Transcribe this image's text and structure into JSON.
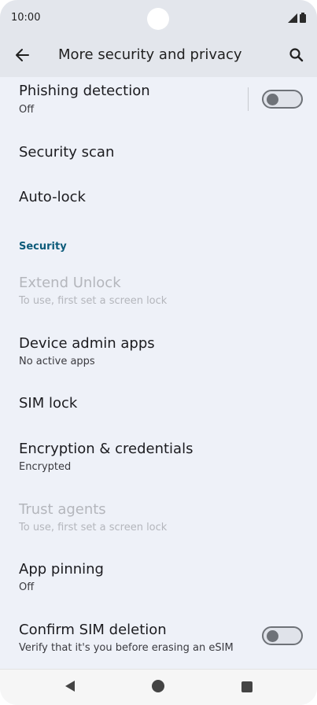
{
  "status_bar": {
    "time": "10:00"
  },
  "app_bar": {
    "title": "More security and privacy"
  },
  "items": {
    "phishing": {
      "title": "Phishing detection",
      "subtitle": "Off",
      "toggle_state": "off"
    },
    "security_scan": {
      "title": "Security scan"
    },
    "auto_lock": {
      "title": "Auto-lock"
    },
    "section_security": "Security",
    "extend_unlock": {
      "title": "Extend Unlock",
      "subtitle": "To use, first set a screen lock"
    },
    "device_admin": {
      "title": "Device admin apps",
      "subtitle": "No active apps"
    },
    "sim_lock": {
      "title": "SIM lock"
    },
    "encryption": {
      "title": "Encryption & credentials",
      "subtitle": "Encrypted"
    },
    "trust_agents": {
      "title": "Trust agents",
      "subtitle": "To use, first set a screen lock"
    },
    "app_pinning": {
      "title": "App pinning",
      "subtitle": "Off"
    },
    "confirm_sim": {
      "title": "Confirm SIM deletion",
      "subtitle": "Verify that it's you before erasing an eSIM",
      "toggle_state": "off"
    }
  },
  "icons": {
    "back": "arrow-left-icon",
    "search": "search-icon",
    "signal": "signal-icon",
    "battery": "battery-icon",
    "nav_back": "triangle-back-icon",
    "nav_home": "circle-home-icon",
    "nav_recents": "square-recents-icon"
  },
  "colors": {
    "accent": "#0d5b7a",
    "background": "#eef1f8",
    "bar": "#e3e6ec"
  }
}
